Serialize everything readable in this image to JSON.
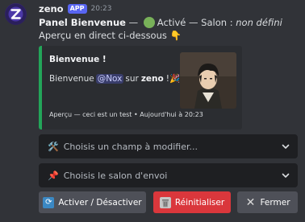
{
  "message": {
    "bot_name": "zeno",
    "badge": "APP",
    "timestamp": "20:23",
    "title_bold": "Panel Bienvenue",
    "sep1": " — ",
    "status": "Activé",
    "sep2": " — Salon : ",
    "salon_value": "non défini",
    "preview_text": "Aperçu en direct ci-dessous",
    "preview_emoji": "👇"
  },
  "embed": {
    "title": "Bienvenue !",
    "desc_prefix": "Bienvenue",
    "mention": "@Nox",
    "desc_mid": "sur",
    "server": "zeno",
    "desc_suffix": "!",
    "desc_emoji": "🎉",
    "footer": "Aperçu — ceci est un test • Aujourd'hui à 20:23",
    "accent_color": "#23a559"
  },
  "selects": {
    "field": {
      "emoji": "🛠️",
      "placeholder": "Choisis un champ à modifier..."
    },
    "channel": {
      "emoji": "📌",
      "placeholder": "Choisis le salon d'envoi"
    }
  },
  "buttons": {
    "toggle": "Activer / Désactiver",
    "reset": "Réinitialiser",
    "close": "Fermer"
  },
  "icons": {
    "toggle": "refresh-icon",
    "reset": "wastebasket-icon",
    "close": "x-icon",
    "dropdown": "chevron-down-icon"
  },
  "colors": {
    "background": "#313338",
    "blurple": "#5865f2",
    "danger": "#da373c",
    "secondary": "#4e5058",
    "embed_bg": "#2b2d31"
  }
}
